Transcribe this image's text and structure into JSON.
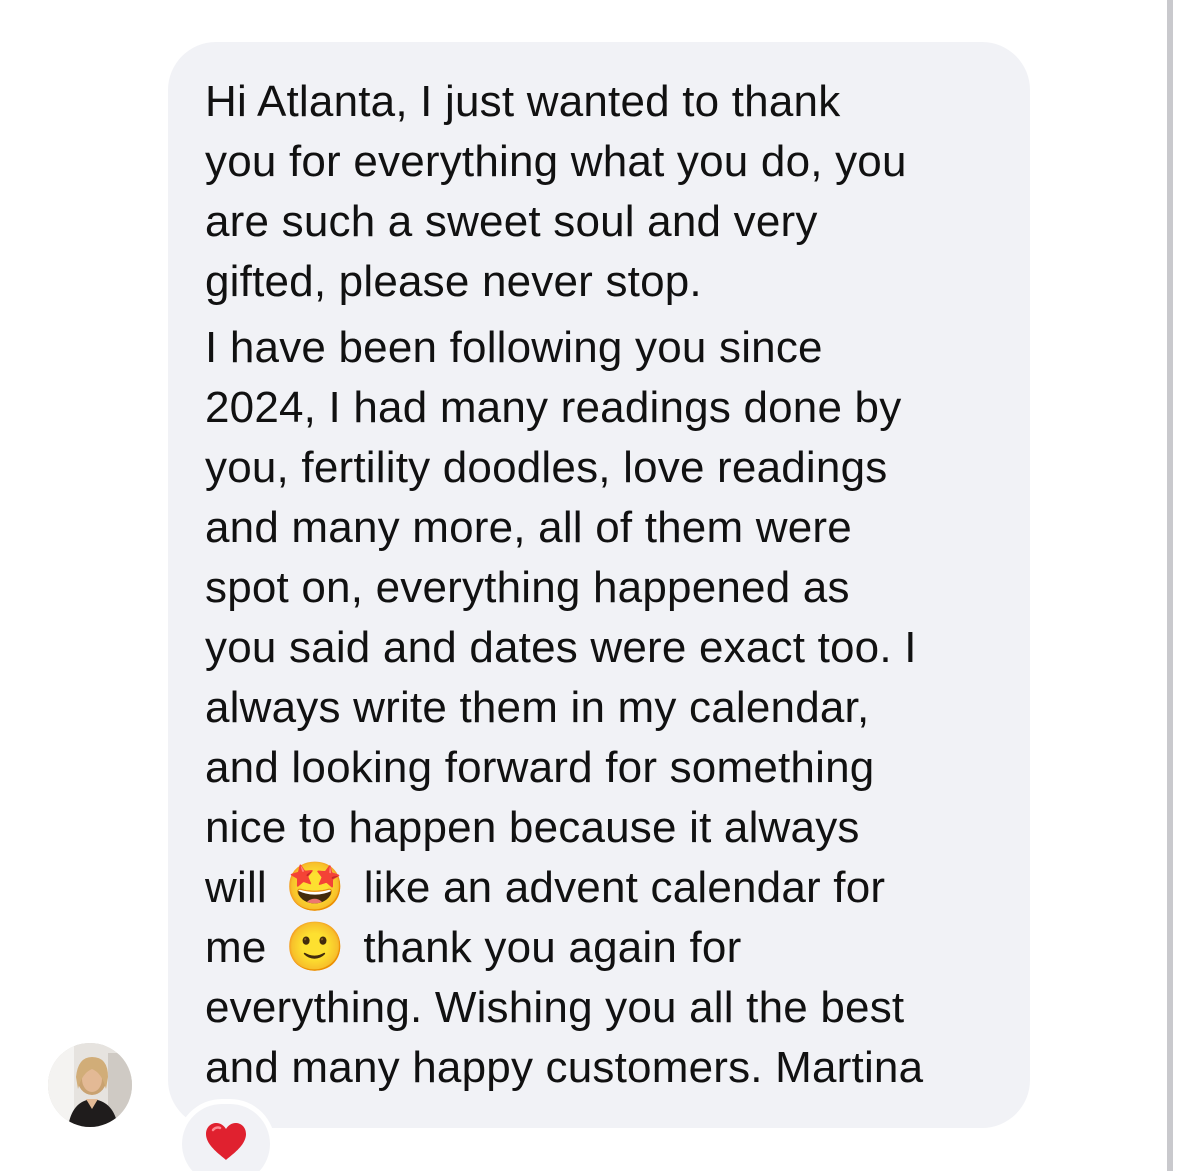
{
  "message": {
    "paragraph_1": [
      "Hi Atlanta, I just wanted to thank",
      "you for everything what you do, you",
      "are such a sweet soul and very",
      "gifted, please never stop."
    ],
    "paragraph_2": [
      "I have been following you since",
      "2024, I had many readings done by",
      "you, fertility doodles, love readings",
      "and many more, all of them were",
      "spot on, everything happened as",
      "you said and dates were exact too. I",
      "always write them in my calendar,",
      "and looking forward for something",
      "nice to happen because it always"
    ],
    "line_emoji_1": {
      "before": "will",
      "emoji": "🤩",
      "emoji_icon": "star-struck-emoji-icon",
      "after": "like an advent calendar for"
    },
    "line_emoji_2": {
      "before": "me",
      "emoji": "🙂",
      "emoji_icon": "slightly-smiling-face-emoji-icon",
      "after": "thank you again for"
    },
    "paragraph_2_end": [
      "everything. Wishing you all the best",
      "and many happy customers. Martina"
    ]
  },
  "reaction": {
    "icon": "red-heart-icon",
    "color": "#e0212f"
  },
  "avatar": {
    "icon": "profile-photo-avatar"
  },
  "colors": {
    "bubble_background": "#f1f2f6",
    "text": "#111111",
    "page_background": "#ffffff",
    "scrollbar": "#c9c9cd"
  }
}
